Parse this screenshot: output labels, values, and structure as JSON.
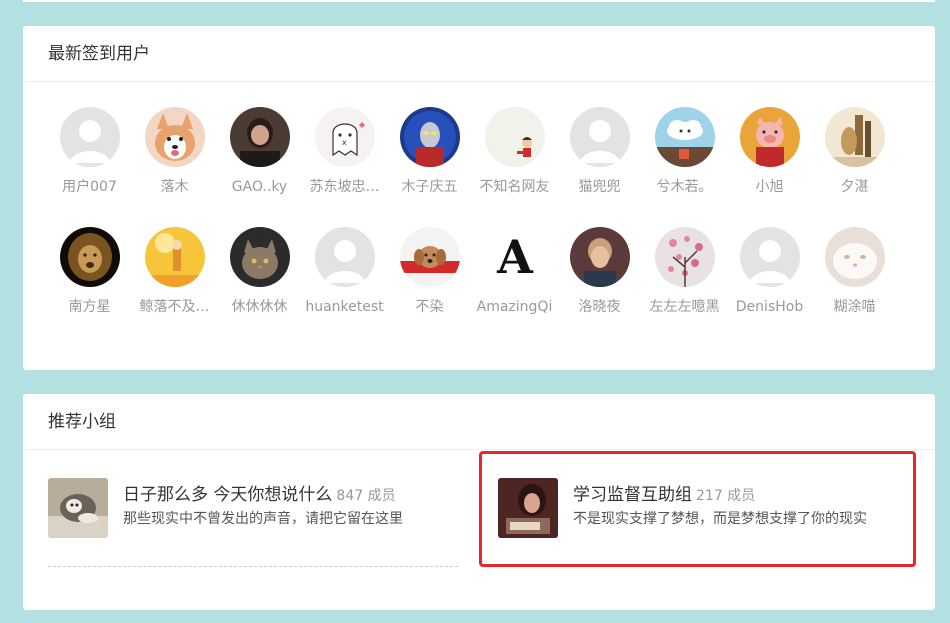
{
  "latest_users": {
    "title": "最新签到用户",
    "rows": [
      [
        {
          "name": "用户007",
          "avatar": "default-avatar"
        },
        {
          "name": "落木",
          "avatar": "corgi-avatar"
        },
        {
          "name": "GAO..ky",
          "avatar": "person-photo-avatar"
        },
        {
          "name": "苏东坡忠…",
          "avatar": "ghost-avatar"
        },
        {
          "name": "木子庆五",
          "avatar": "hero-figure-avatar"
        },
        {
          "name": "不知名网友",
          "avatar": "cartoon-kid-avatar"
        },
        {
          "name": "猫兜兜",
          "avatar": "default-avatar"
        },
        {
          "name": "兮木若。",
          "avatar": "cloud-avatar"
        },
        {
          "name": "小旭",
          "avatar": "pig-avatar"
        },
        {
          "name": "夕湛",
          "avatar": "painting-avatar"
        }
      ],
      [
        {
          "name": "南方星",
          "avatar": "lion-avatar"
        },
        {
          "name": "鲸落不及…",
          "avatar": "yellow-figure-avatar"
        },
        {
          "name": "休休休休",
          "avatar": "cat-avatar"
        },
        {
          "name": "huanketest",
          "avatar": "default-avatar"
        },
        {
          "name": "不染",
          "avatar": "dog-avatar"
        },
        {
          "name": "AmazingQi",
          "avatar": "letter-a-avatar"
        },
        {
          "name": "洛晓夜",
          "avatar": "portrait-avatar"
        },
        {
          "name": "左左左噫黑",
          "avatar": "blossom-avatar"
        },
        {
          "name": "DenisHob",
          "avatar": "default-avatar"
        },
        {
          "name": "糊涂喵",
          "avatar": "white-cat-avatar"
        }
      ]
    ]
  },
  "recommended_groups": {
    "title": "推荐小组",
    "groups": [
      {
        "name": "日子那么多 今天你想说什么",
        "members": "847 成员",
        "description": "那些现实中不曾发出的声音，请把它留在这里",
        "thumb": "sleeping-cat-thumb"
      },
      {
        "name": "学习监督互助组",
        "members": "217 成员",
        "description": "不是现实支撑了梦想，而是梦想支撑了你的现实",
        "thumb": "studying-girl-thumb"
      }
    ]
  },
  "highlight_color": "#e8262d",
  "background_color": "#b3e0e0"
}
